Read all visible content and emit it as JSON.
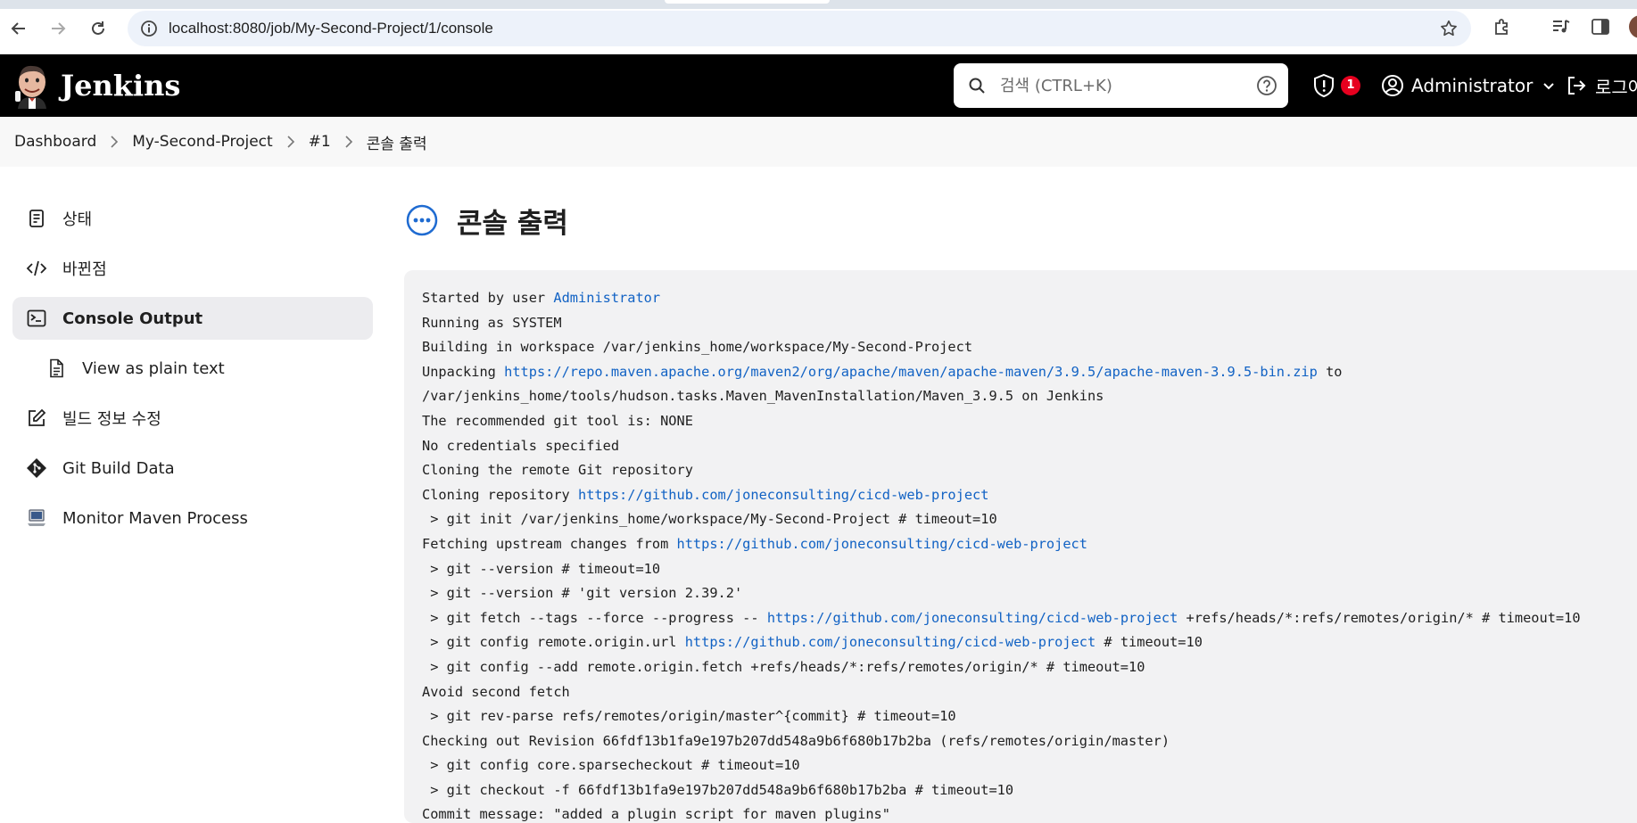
{
  "browser": {
    "url": "localhost:8080/job/My-Second-Project/1/console"
  },
  "header": {
    "brand": "Jenkins",
    "search_placeholder": "검색 (CTRL+K)",
    "notification_count": "1",
    "user_name": "Administrator",
    "logout_label": "로그아웃"
  },
  "breadcrumb": {
    "items": [
      "Dashboard",
      "My-Second-Project",
      "#1",
      "콘솔 출력"
    ]
  },
  "sidebar": {
    "items": [
      {
        "label": "상태",
        "icon": "status-document-icon"
      },
      {
        "label": "바뀐점",
        "icon": "code-icon"
      },
      {
        "label": "Console Output",
        "icon": "terminal-icon"
      },
      {
        "label": "View as plain text",
        "icon": "text-file-icon"
      },
      {
        "label": "빌드 정보 수정",
        "icon": "edit-icon"
      },
      {
        "label": "Git Build Data",
        "icon": "git-icon"
      },
      {
        "label": "Monitor Maven Process",
        "icon": "computer-icon"
      }
    ]
  },
  "main": {
    "title": "콘솔 출력"
  },
  "console": {
    "lines": [
      [
        {
          "t": "Started by user "
        },
        {
          "t": "Administrator",
          "link": true
        }
      ],
      [
        {
          "t": "Running as SYSTEM"
        }
      ],
      [
        {
          "t": "Building in workspace /var/jenkins_home/workspace/My-Second-Project"
        }
      ],
      [
        {
          "t": "Unpacking "
        },
        {
          "t": "https://repo.maven.apache.org/maven2/org/apache/maven/apache-maven/3.9.5/apache-maven-3.9.5-bin.zip",
          "link": true
        },
        {
          "t": " to"
        }
      ],
      [
        {
          "t": "/var/jenkins_home/tools/hudson.tasks.Maven_MavenInstallation/Maven_3.9.5 on Jenkins"
        }
      ],
      [
        {
          "t": "The recommended git tool is: NONE"
        }
      ],
      [
        {
          "t": "No credentials specified"
        }
      ],
      [
        {
          "t": "Cloning the remote Git repository"
        }
      ],
      [
        {
          "t": "Cloning repository "
        },
        {
          "t": "https://github.com/joneconsulting/cicd-web-project",
          "link": true
        }
      ],
      [
        {
          "t": " > git init /var/jenkins_home/workspace/My-Second-Project # timeout=10"
        }
      ],
      [
        {
          "t": "Fetching upstream changes from "
        },
        {
          "t": "https://github.com/joneconsulting/cicd-web-project",
          "link": true
        }
      ],
      [
        {
          "t": " > git --version # timeout=10"
        }
      ],
      [
        {
          "t": " > git --version # 'git version 2.39.2'"
        }
      ],
      [
        {
          "t": " > git fetch --tags --force --progress -- "
        },
        {
          "t": "https://github.com/joneconsulting/cicd-web-project",
          "link": true
        },
        {
          "t": " +refs/heads/*:refs/remotes/origin/* # timeout=10"
        }
      ],
      [
        {
          "t": " > git config remote.origin.url "
        },
        {
          "t": "https://github.com/joneconsulting/cicd-web-project",
          "link": true
        },
        {
          "t": " # timeout=10"
        }
      ],
      [
        {
          "t": " > git config --add remote.origin.fetch +refs/heads/*:refs/remotes/origin/* # timeout=10"
        }
      ],
      [
        {
          "t": "Avoid second fetch"
        }
      ],
      [
        {
          "t": " > git rev-parse refs/remotes/origin/master^{commit} # timeout=10"
        }
      ],
      [
        {
          "t": "Checking out Revision 66fdf13b1fa9e197b207dd548a9b6f680b17b2ba (refs/remotes/origin/master)"
        }
      ],
      [
        {
          "t": " > git config core.sparsecheckout # timeout=10"
        }
      ],
      [
        {
          "t": " > git checkout -f 66fdf13b1fa9e197b207dd548a9b6f680b17b2ba # timeout=10"
        }
      ],
      [
        {
          "t": "Commit message: \"added a plugin script for maven plugins\""
        }
      ]
    ]
  },
  "colors": {
    "header_bg": "#000000",
    "link": "#1162c4",
    "badge": "#e6001f",
    "console_bg": "#f2f2f3",
    "active_item_bg": "#ececef"
  }
}
